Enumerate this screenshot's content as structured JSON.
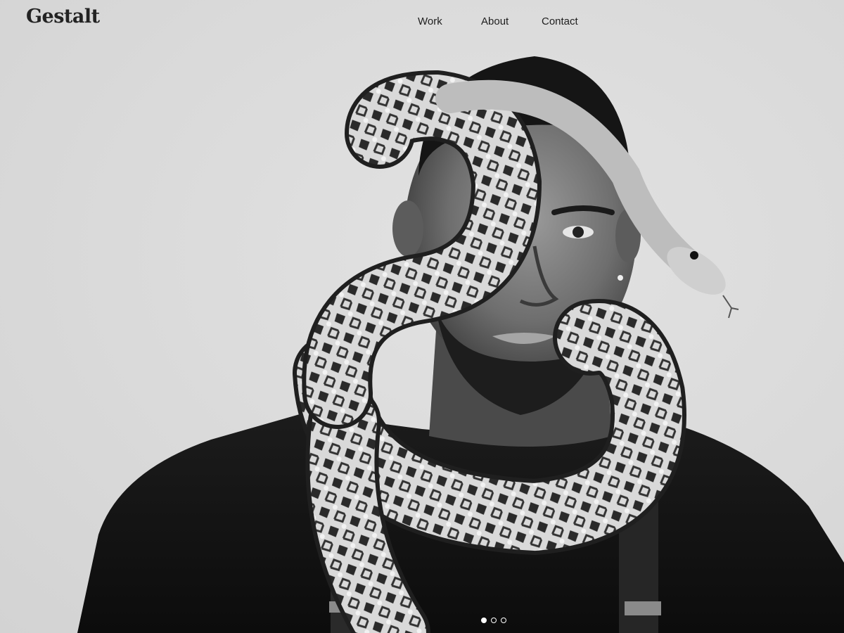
{
  "header": {
    "logo": "Gestalt",
    "nav": [
      {
        "label": "Work"
      },
      {
        "label": "About"
      },
      {
        "label": "Contact"
      }
    ]
  },
  "hero": {
    "image_subject": "black-and-white portrait of a man with a python snake coiled around his head and neck",
    "slides_total": 3,
    "active_slide": 1
  },
  "colors": {
    "background": "#dcdcdc",
    "text": "#1e1e1e",
    "pager_dot": "#ffffff"
  }
}
